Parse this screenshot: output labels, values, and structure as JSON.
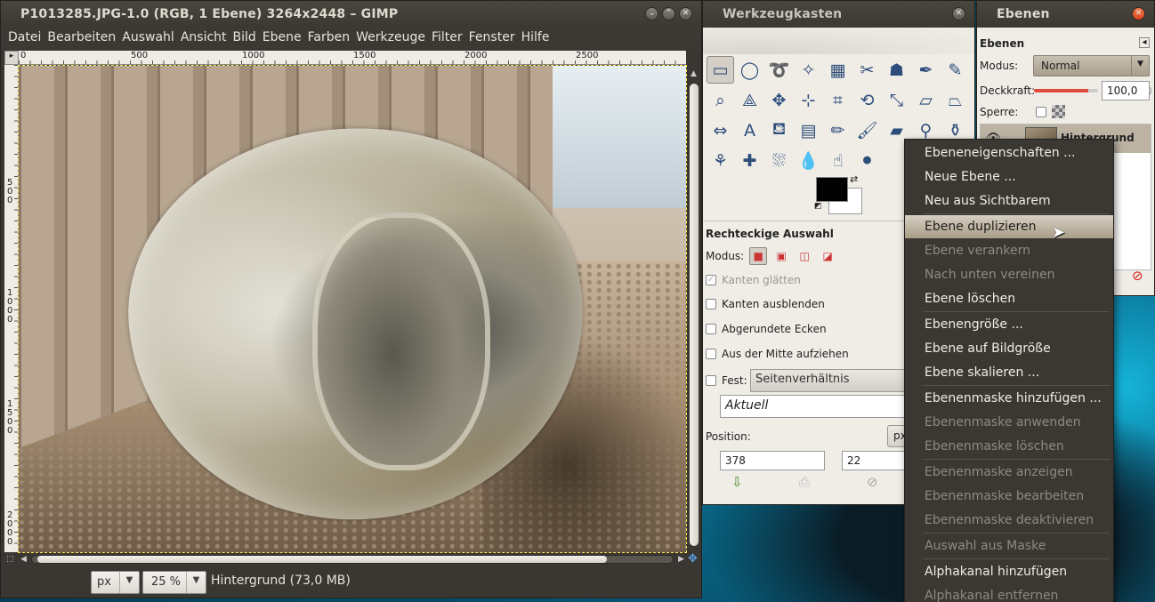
{
  "image_window": {
    "title": "P1013285.JPG-1.0 (RGB, 1 Ebene) 3264x2448 – GIMP",
    "menu": [
      "Datei",
      "Bearbeiten",
      "Auswahl",
      "Ansicht",
      "Bild",
      "Ebene",
      "Farben",
      "Werkzeuge",
      "Filter",
      "Fenster",
      "Hilfe"
    ],
    "ruler_h": [
      "0",
      "500",
      "1000",
      "1500",
      "2000",
      "2500"
    ],
    "ruler_v": [
      "500",
      "1000",
      "1500",
      "2000"
    ],
    "unit": "px",
    "zoom": "25 %",
    "status": "Hintergrund (73,0 MB)"
  },
  "toolbox": {
    "title": "Werkzeugkasten",
    "options_title": "Rechteckige Auswahl",
    "mode_label": "Modus:",
    "antialias_label": "Kanten glätten",
    "feather_label": "Kanten ausblenden",
    "rounded_label": "Abgerundete Ecken",
    "expand_center_label": "Aus der Mitte aufziehen",
    "fixed_label": "Fest:",
    "fixed_value": "Seitenverhältnis",
    "current_value": "Aktuell",
    "position_label": "Position:",
    "position_unit": "px",
    "pos_x": "378",
    "pos_y": "22"
  },
  "layers": {
    "title": "Ebenen",
    "section": "Ebenen",
    "mode_label": "Modus:",
    "mode_value": "Normal",
    "opacity_label": "Deckkraft:",
    "opacity_value": "100,0",
    "opacity_fraction": 1.0,
    "lock_label": "Sperre:",
    "layer_name": "Hintergrund"
  },
  "context_menu": [
    {
      "label": "Ebeneneigenschaften ...",
      "enabled": true
    },
    {
      "label": "Neue Ebene ...",
      "enabled": true
    },
    {
      "label": "Neu aus Sichtbarem",
      "enabled": true
    },
    {
      "label": "Ebene duplizieren",
      "enabled": true,
      "hover": true
    },
    {
      "label": "Ebene verankern",
      "enabled": false
    },
    {
      "label": "Nach unten vereinen",
      "enabled": false
    },
    {
      "label": "Ebene löschen",
      "enabled": true
    },
    {
      "label": "Ebenengröße ...",
      "enabled": true
    },
    {
      "label": "Ebene auf Bildgröße",
      "enabled": true
    },
    {
      "label": "Ebene skalieren ...",
      "enabled": true
    },
    {
      "label": "Ebenenmaske hinzufügen ...",
      "enabled": true
    },
    {
      "label": "Ebenenmaske anwenden",
      "enabled": false
    },
    {
      "label": "Ebenenmaske löschen",
      "enabled": false
    },
    {
      "label": "Ebenenmaske anzeigen",
      "enabled": false
    },
    {
      "label": "Ebenenmaske bearbeiten",
      "enabled": false
    },
    {
      "label": "Ebenenmaske deaktivieren",
      "enabled": false
    },
    {
      "label": "Auswahl aus Maske",
      "enabled": false
    },
    {
      "label": "Alphakanal hinzufügen",
      "enabled": true
    },
    {
      "label": "Alphakanal entfernen",
      "enabled": false
    }
  ],
  "tools": [
    {
      "name": "rect-select-icon",
      "glyph": "▭",
      "active": true
    },
    {
      "name": "ellipse-select-icon",
      "glyph": "◯"
    },
    {
      "name": "lasso-icon",
      "glyph": "➰"
    },
    {
      "name": "fuzzy-select-icon",
      "glyph": "✧"
    },
    {
      "name": "color-select-icon",
      "glyph": "▦"
    },
    {
      "name": "scissors-icon",
      "glyph": "✂"
    },
    {
      "name": "foreground-select-icon",
      "glyph": "☗"
    },
    {
      "name": "paths-icon",
      "glyph": "✒"
    },
    {
      "name": "color-picker-icon",
      "glyph": "✎"
    },
    {
      "name": "zoom-icon",
      "glyph": "⌕"
    },
    {
      "name": "measure-icon",
      "glyph": "⟁"
    },
    {
      "name": "move-icon",
      "glyph": "✥"
    },
    {
      "name": "align-icon",
      "glyph": "⊹"
    },
    {
      "name": "crop-icon",
      "glyph": "⌗"
    },
    {
      "name": "rotate-icon",
      "glyph": "⟲"
    },
    {
      "name": "scale-icon",
      "glyph": "⤡"
    },
    {
      "name": "shear-icon",
      "glyph": "▱"
    },
    {
      "name": "perspective-icon",
      "glyph": "⏢"
    },
    {
      "name": "flip-icon",
      "glyph": "⇔"
    },
    {
      "name": "text-icon",
      "glyph": "A"
    },
    {
      "name": "bucket-fill-icon",
      "glyph": "⛾"
    },
    {
      "name": "blend-icon",
      "glyph": "▤"
    },
    {
      "name": "pencil-icon",
      "glyph": "✏"
    },
    {
      "name": "paintbrush-icon",
      "glyph": "🖌"
    },
    {
      "name": "eraser-icon",
      "glyph": "▰"
    },
    {
      "name": "airbrush-icon",
      "glyph": "⚲"
    },
    {
      "name": "ink-icon",
      "glyph": "⚱"
    },
    {
      "name": "clone-icon",
      "glyph": "⚘"
    },
    {
      "name": "heal-icon",
      "glyph": "✚"
    },
    {
      "name": "perspective-clone-icon",
      "glyph": "⛆"
    },
    {
      "name": "blur-icon",
      "glyph": "💧"
    },
    {
      "name": "smudge-icon",
      "glyph": "☝"
    },
    {
      "name": "dodge-burn-icon",
      "glyph": "⚫"
    }
  ]
}
